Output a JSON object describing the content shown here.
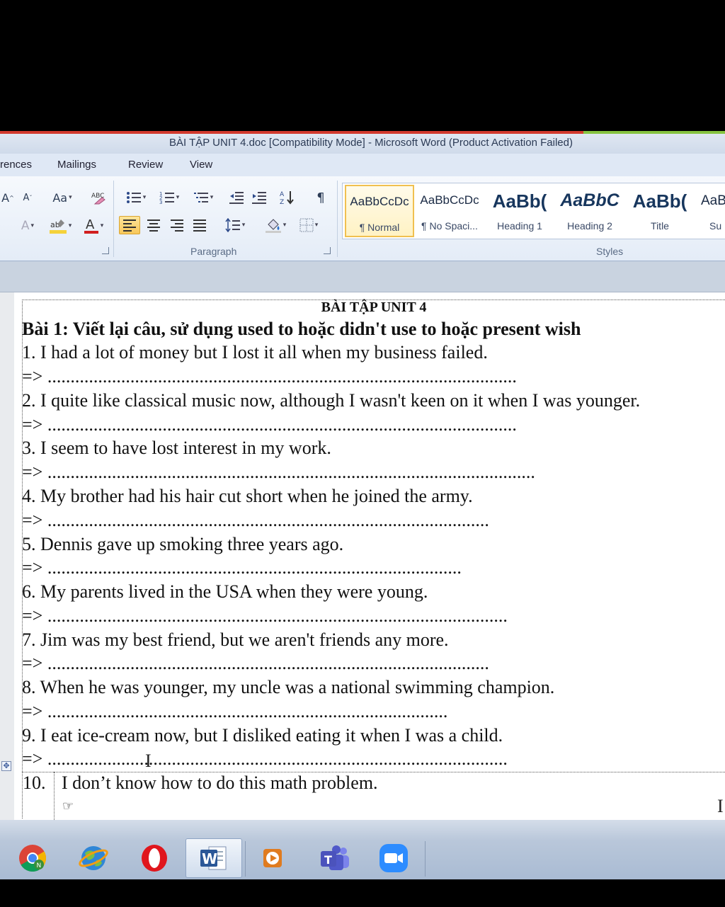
{
  "window": {
    "title": "BÀI TẬP UNIT 4.doc [Compatibility Mode] - Microsoft Word (Product Activation Failed)"
  },
  "ribbon": {
    "tabs": [
      "rences",
      "Mailings",
      "Review",
      "View"
    ],
    "groups": {
      "paragraph": "Paragraph",
      "styles": "Styles"
    },
    "styles": [
      {
        "sample": "AaBbCcDc",
        "name": "¶ Normal"
      },
      {
        "sample": "AaBbCcDc",
        "name": "¶ No Spaci..."
      },
      {
        "sample": "AaBb(",
        "name": "Heading 1"
      },
      {
        "sample": "AaBbC",
        "name": "Heading 2"
      },
      {
        "sample": "AaBb(",
        "name": "Title"
      },
      {
        "sample": "AaB",
        "name": "Su"
      }
    ],
    "colors": {
      "highlight": "#f5d23a",
      "font_color": "#d11f1f"
    }
  },
  "document": {
    "title": "BÀI TẬP UNIT 4",
    "heading": "Bài 1: Viết lại câu, sử dụng used to hoặc didn't use to hoặc present wish",
    "questions": [
      {
        "text": "1. I had a lot of money but I lost it all when my business failed.",
        "answer": "=> ......................................................................................................"
      },
      {
        "text": "2. I quite like classical music now, although I wasn't keen on it when I was younger.",
        "answer": "=> ......................................................................................................"
      },
      {
        "text": "3. I seem to have lost interest in my work.",
        "answer": "=> .........................................................................................................."
      },
      {
        "text": "4. My brother had his hair cut short when he joined the army.",
        "answer": "=> ................................................................................................"
      },
      {
        "text": "5. Dennis gave up smoking three years ago.",
        "answer": "=> .........................................................................................."
      },
      {
        "text": "6. My parents lived in the USA when they were young.",
        "answer": "=> ...................................................................................................."
      },
      {
        "text": "7. Jim was my best friend, but we aren't friends any more.",
        "answer": "=> ................................................................................................"
      },
      {
        "text": "8. When he was younger, my uncle was a national swimming champion.",
        "answer": "=> ......................................................................................."
      },
      {
        "text": "9. I eat ice-cream now, but I disliked eating it when I was a child.",
        "answer": "=> ...................................................................................................."
      }
    ],
    "table_row": {
      "num": "10.",
      "text": "I don’t know how to do this math problem."
    }
  },
  "taskbar": {
    "apps": [
      "chrome-icon",
      "browser-globe-icon",
      "opera-icon",
      "word-icon",
      "media-player-icon",
      "teams-icon",
      "zoom-icon"
    ]
  }
}
